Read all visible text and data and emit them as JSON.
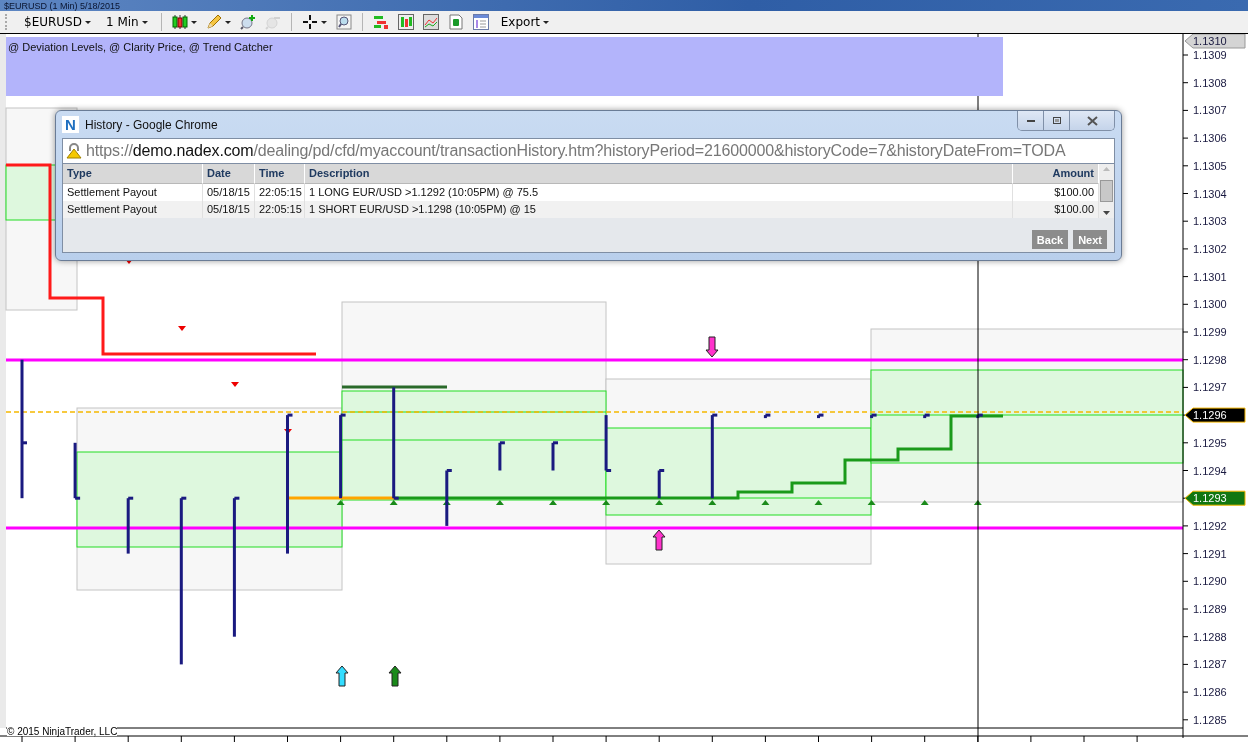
{
  "window": {
    "title": "$EURUSD (1 Min)  5/18/2015"
  },
  "toolbar": [
    {
      "kind": "dropdown",
      "label": "$EURUSD"
    },
    {
      "kind": "dropdown",
      "label": "1 Min"
    },
    {
      "kind": "separator"
    },
    {
      "kind": "button",
      "menu": true,
      "disabled": false
    },
    {
      "kind": "button",
      "menu": true,
      "disabled": false
    },
    {
      "kind": "button",
      "menu": false,
      "disabled": false
    },
    {
      "kind": "button",
      "menu": false,
      "disabled": true
    },
    {
      "kind": "separator"
    },
    {
      "kind": "button",
      "menu": true,
      "disabled": false
    },
    {
      "kind": "button",
      "menu": false,
      "disabled": false
    },
    {
      "kind": "separator"
    },
    {
      "kind": "button",
      "menu": false,
      "disabled": false
    },
    {
      "kind": "button",
      "menu": false,
      "disabled": false
    },
    {
      "kind": "button",
      "menu": false,
      "disabled": false
    },
    {
      "kind": "button",
      "menu": false,
      "disabled": false
    },
    {
      "kind": "button",
      "menu": false,
      "disabled": false
    },
    {
      "kind": "dropdown",
      "label": "Export"
    }
  ],
  "chart": {
    "indicators_label": "@ Deviation Levels, @ Clarity Price, @ Trend Catcher",
    "copyright": "© 2015 NinjaTrader, LLC",
    "price_axis": [
      {
        "kind": "tag",
        "label": "1.1310",
        "color": "#d4d4d4"
      },
      {
        "kind": "tick",
        "label": "1.1309"
      },
      {
        "kind": "tick",
        "label": "1.1308"
      },
      {
        "kind": "tick",
        "label": "1.1307"
      },
      {
        "kind": "tick",
        "label": "1.1306"
      },
      {
        "kind": "tick",
        "label": "1.1305"
      },
      {
        "kind": "tick",
        "label": "1.1304"
      },
      {
        "kind": "tick",
        "label": "1.1303"
      },
      {
        "kind": "tick",
        "label": "1.1302"
      },
      {
        "kind": "tick",
        "label": "1.1301"
      },
      {
        "kind": "tick",
        "label": "1.1300"
      },
      {
        "kind": "tick",
        "label": "1.1299"
      },
      {
        "kind": "tick",
        "label": "1.1298"
      },
      {
        "kind": "tick",
        "label": "1.1297"
      },
      {
        "kind": "tag",
        "label": "1.1296",
        "color": "#000000"
      },
      {
        "kind": "tick",
        "label": "1.1295"
      },
      {
        "kind": "tick",
        "label": "1.1294"
      },
      {
        "kind": "tag",
        "label": "1.1293",
        "color": "#117711"
      },
      {
        "kind": "tick",
        "label": "1.1292"
      },
      {
        "kind": "tick",
        "label": "1.1291"
      },
      {
        "kind": "tick",
        "label": "1.1290"
      },
      {
        "kind": "tick",
        "label": "1.1289"
      },
      {
        "kind": "tick",
        "label": "1.1288"
      },
      {
        "kind": "tick",
        "label": "1.1287"
      },
      {
        "kind": "tick",
        "label": "1.1286"
      },
      {
        "kind": "tick",
        "label": "1.1285"
      }
    ]
  },
  "history_window": {
    "logo": "N",
    "title": "History - Google Chrome",
    "url": {
      "scheme": "https://",
      "host": "demo.nadex.com",
      "path": "/dealing/pd/cfd/myaccount/transactionHistory.htm?historyPeriod=21600000&historyCode=7&historyDateFrom=TODA"
    },
    "table": {
      "columns": [
        "Type",
        "Date",
        "Time",
        "Description",
        "Amount"
      ],
      "rows": [
        [
          "Settlement Payout",
          "05/18/15",
          "22:05:15",
          "1 LONG EUR/USD >1.1292 (10:05PM) @ 75.5",
          "$100.00"
        ],
        [
          "Settlement Payout",
          "05/18/15",
          "22:05:15",
          "1 SHORT EUR/USD >1.1298 (10:05PM) @ 15",
          "$100.00"
        ]
      ]
    },
    "buttons": [
      "Back",
      "Next"
    ]
  }
}
